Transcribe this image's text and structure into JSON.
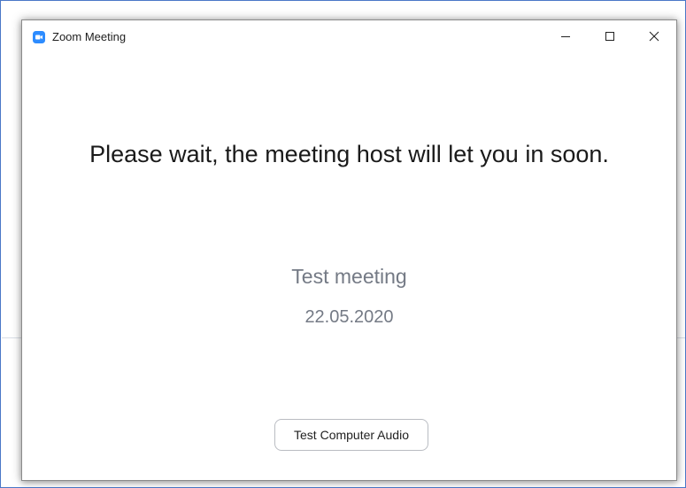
{
  "window": {
    "title": "Zoom Meeting",
    "app_icon": "zoom-video-camera-icon",
    "controls": {
      "minimize_icon": "minimize-icon",
      "maximize_icon": "maximize-icon",
      "close_icon": "close-icon"
    }
  },
  "waiting_room": {
    "message": "Please wait, the meeting host will let you in soon.",
    "meeting_title": "Test meeting",
    "meeting_date": "22.05.2020",
    "audio_button_label": "Test Computer Audio"
  },
  "colors": {
    "accent": "#2d8cff",
    "frame_border": "#4a78c8",
    "secondary_text": "#747a85"
  }
}
